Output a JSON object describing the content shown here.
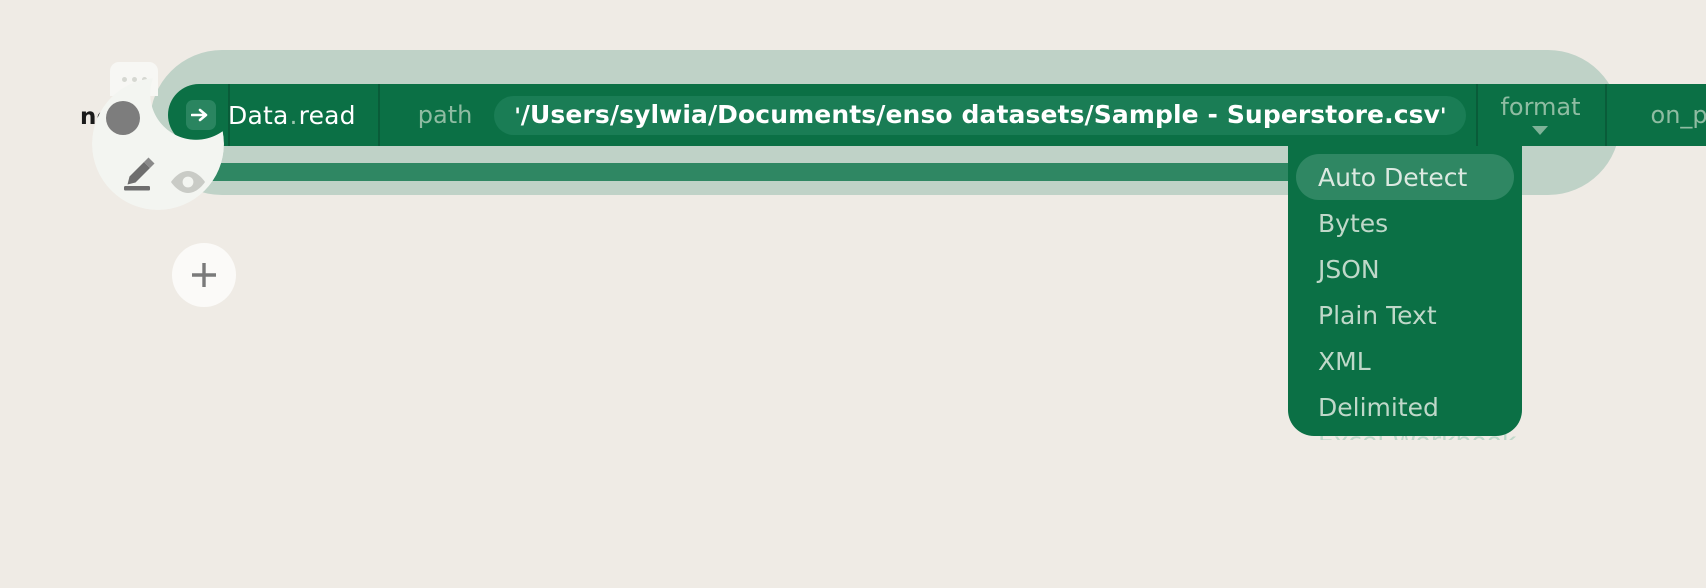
{
  "canvas": {
    "background_color": "#EFEBE5"
  },
  "node": {
    "name_label": "node",
    "execute_icon": "arrow-right-icon",
    "expression_prefix": "Data",
    "expression_separator": ".",
    "expression_method": "read",
    "colors": {
      "node_body": "#0B7045",
      "halo": "#BFD2C7",
      "wire": "#2F8763",
      "widget_pill": "#1A7D55",
      "dim_text": "#8FBCA2"
    },
    "arguments": [
      {
        "label": "path",
        "kind": "text-widget",
        "open_quote": "'",
        "value": "/Users/sylwia/Documents/enso  datasets/Sample  -  Superstore.csv",
        "close_quote": "'"
      },
      {
        "label": "format",
        "kind": "dropdown",
        "caret": "chevron-down-icon"
      },
      {
        "label": "on_problems",
        "kind": "dropdown"
      }
    ]
  },
  "format_dropdown": {
    "open": true,
    "selected": "Auto Detect",
    "items": [
      "Auto Detect",
      "Bytes",
      "JSON",
      "Plain Text",
      "XML",
      "Delimited"
    ],
    "overflow_item": "Excel Workbook"
  },
  "hover_menu": {
    "handle_icon": "three-dots-icon",
    "actions": [
      {
        "icon": "record-circle-icon",
        "name": "record-output"
      },
      {
        "icon": "pencil-icon",
        "name": "edit-node"
      },
      {
        "icon": "eye-icon",
        "name": "toggle-visualization"
      }
    ]
  },
  "add_button": {
    "icon": "plus-icon",
    "label": "Add node"
  }
}
